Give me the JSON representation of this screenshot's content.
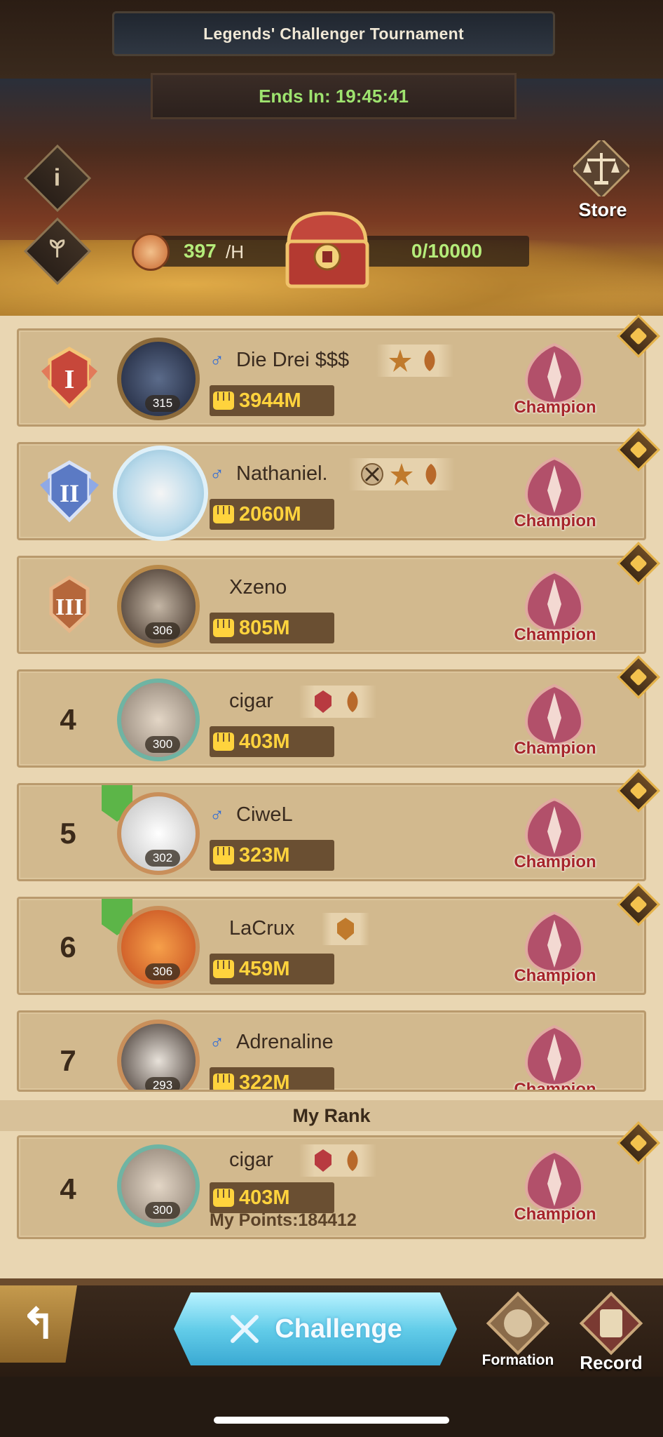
{
  "header": {
    "title": "Legends' Challenger Tournament",
    "timer": "Ends In: 19:45:41",
    "store_label": "Store",
    "rate_value": "397",
    "rate_unit": "/H",
    "points_progress": "0/10000"
  },
  "ranking": [
    {
      "rank": "I",
      "name": "Die Drei $$$",
      "gender": "♂",
      "level": "315",
      "power": "3944M",
      "title": "Champion"
    },
    {
      "rank": "II",
      "name": "Nathaniel.",
      "gender": "♂",
      "level": "",
      "power": "2060M",
      "title": "Champion"
    },
    {
      "rank": "III",
      "name": "Xzeno",
      "gender": "",
      "level": "306",
      "power": "805M",
      "title": "Champion"
    },
    {
      "rank": "4",
      "name": "cigar",
      "gender": "",
      "level": "300",
      "power": "403M",
      "title": "Champion"
    },
    {
      "rank": "5",
      "name": "CiweL",
      "gender": "♂",
      "level": "302",
      "power": "323M",
      "title": "Champion"
    },
    {
      "rank": "6",
      "name": "LaCrux",
      "gender": "",
      "level": "306",
      "power": "459M",
      "title": "Champion"
    },
    {
      "rank": "7",
      "name": "Adrenaline",
      "gender": "♂",
      "level": "293",
      "power": "322M",
      "title": "Champion"
    }
  ],
  "my_rank": {
    "header": "My Rank",
    "rank": "4",
    "name": "cigar",
    "level": "300",
    "power": "403M",
    "points_label": "My Points:184412",
    "title": "Champion"
  },
  "bottom": {
    "challenge_label": "Challenge",
    "formation_label": "Formation",
    "record_label": "Record"
  }
}
